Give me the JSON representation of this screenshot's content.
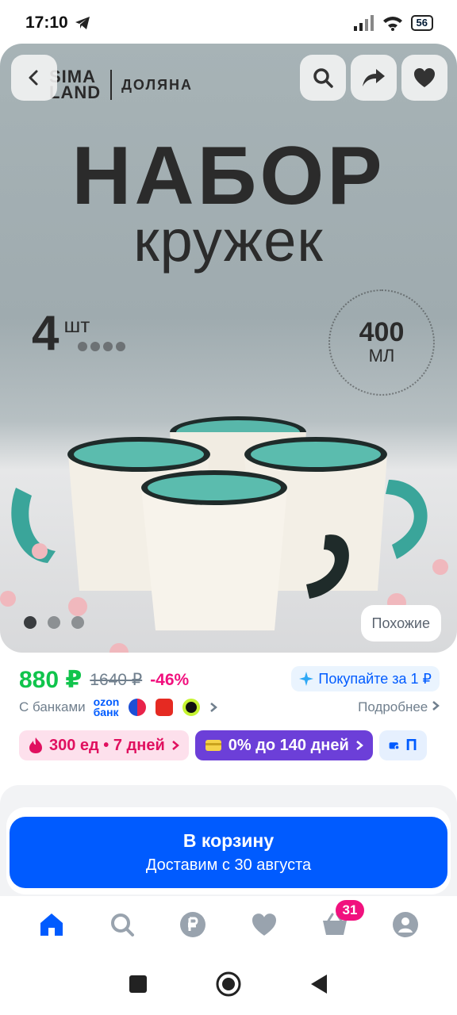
{
  "status_bar": {
    "time": "17:10",
    "battery": "56"
  },
  "hero": {
    "brand_sima_line1": "SIMA",
    "brand_sima_line2": "LAND",
    "brand_dolyana": "ДОЛЯНА",
    "title": "НАБОР",
    "subtitle": "кружек",
    "count_number": "4",
    "count_unit": "шт",
    "volume_value": "400",
    "volume_unit": "МЛ",
    "carousel_dots_total": 3,
    "carousel_active_index": 0,
    "similar_button": "Похожие"
  },
  "pricing": {
    "price": "880 ₽",
    "old_price": "1640 ₽",
    "discount": "-46%",
    "buy_for_label": "Покупайте за 1 ₽",
    "banks_label": "С банками",
    "ozon_bank_line1": "ozon",
    "ozon_bank_line2": "банк",
    "more_label": "Подробнее"
  },
  "chips": [
    {
      "label": "300 ед • 7 дней",
      "color": "#e0105f"
    },
    {
      "label": "0% до 140 дней",
      "color": "#6c3fd8"
    },
    {
      "label": "П",
      "color": "#005bff"
    }
  ],
  "cart_button": {
    "label": "В корзину",
    "delivery": "Доставим с 30 августа"
  },
  "tab_bar": {
    "items": [
      "home-icon",
      "search-icon",
      "ruble-icon",
      "heart-icon",
      "basket-icon",
      "profile-icon"
    ],
    "cart_badge": "31"
  },
  "colors": {
    "accent": "#005bff",
    "price": "#10c44c",
    "discount": "#f1117e",
    "badge": "#f1117e"
  }
}
